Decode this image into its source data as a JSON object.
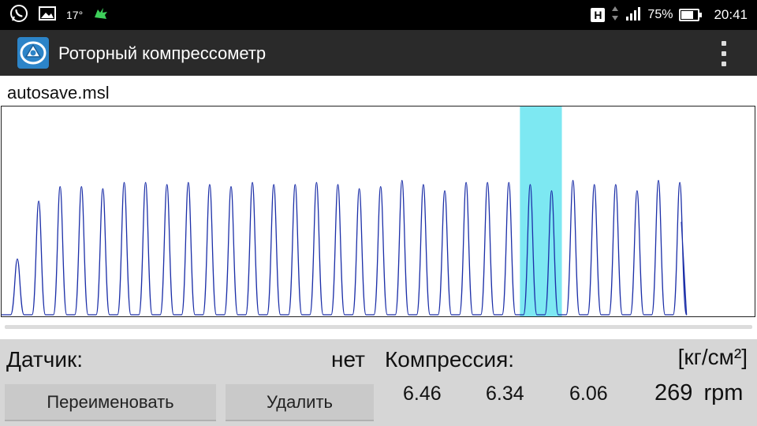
{
  "status_bar": {
    "temperature": "17°",
    "network_badge": "H",
    "battery_percent": "75%",
    "battery_level": 0.75,
    "time": "20:41",
    "icons": [
      "whatsapp-icon",
      "gallery-icon",
      "android-icon",
      "network-h-icon",
      "signal-icon",
      "battery-icon"
    ]
  },
  "app_bar": {
    "title": "Роторный компрессометр",
    "icon": "rotary-engine-icon",
    "menu_icon": "overflow-menu-icon"
  },
  "file": {
    "name": "autosave.msl"
  },
  "chart_data": {
    "type": "line",
    "title": "",
    "xlabel": "",
    "ylabel": "",
    "ylim": [
      0,
      1
    ],
    "grid": false,
    "series": [
      {
        "peaks": [
          0.27,
          0.55,
          0.62,
          0.62,
          0.61,
          0.64,
          0.64,
          0.63,
          0.64,
          0.63,
          0.62,
          0.64,
          0.63,
          0.63,
          0.64,
          0.63,
          0.61,
          0.62,
          0.65,
          0.63,
          0.6,
          0.64,
          0.64,
          0.64,
          0.63,
          0.6,
          0.65,
          0.63,
          0.63,
          0.6,
          0.65,
          0.64
        ],
        "color": "#1c2fa8"
      }
    ],
    "highlight": {
      "from_peak": 24,
      "to_peak": 25,
      "color": "#7de8f2"
    }
  },
  "bottom": {
    "sensor_label": "Датчик:",
    "sensor_value": "нет",
    "compression_label": "Компрессия:",
    "units": "[кг/см²]",
    "values": [
      "6.46",
      "6.34",
      "6.06"
    ],
    "rpm": "269 rpm",
    "rename_button": "Переименовать",
    "delete_button": "Удалить"
  }
}
